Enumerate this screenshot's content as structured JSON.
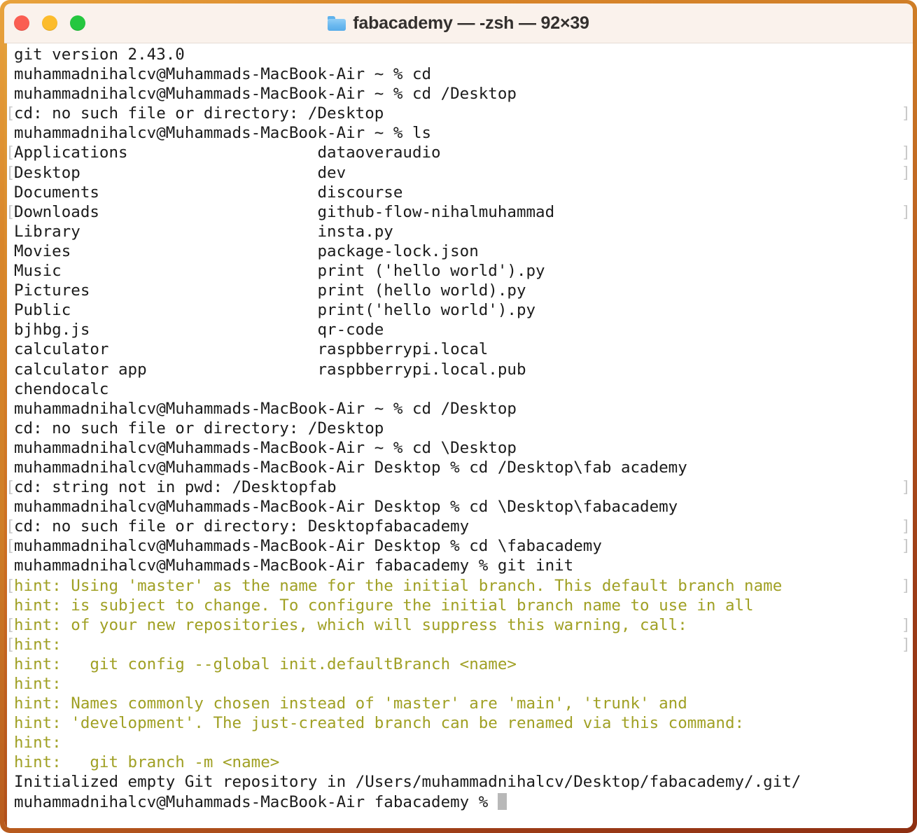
{
  "window": {
    "title": "fabacademy — -zsh — 92×39",
    "folder_icon": "folder-icon",
    "columns": 92,
    "rows": 39,
    "shell": "-zsh",
    "directory": "fabacademy",
    "traffic_lights": {
      "close_label": "close",
      "minimize_label": "minimize",
      "maximize_label": "maximize",
      "close_color": "#fa5e52",
      "minimize_color": "#fcbc2c",
      "maximize_color": "#25c73f"
    },
    "colors": {
      "frame_border": "#d9862a",
      "titlebar_bg": "#faf2ec",
      "body_bg": "#ffffff",
      "text": "#1b1b1b",
      "hint_text": "#a0a024",
      "cursor": "#b8b8b8",
      "mark_glyph": "#c9c9c9"
    }
  },
  "terminal": {
    "prompt_user_host": "muhammadnihalcv@Muhammads-MacBook-Air",
    "cursor_glyph": "block-cursor",
    "lines": [
      {
        "text": "git version 2.43.0",
        "hint": false,
        "mark_left": false,
        "mark_right": false
      },
      {
        "text": "muhammadnihalcv@Muhammads-MacBook-Air ~ % cd",
        "hint": false,
        "mark_left": false,
        "mark_right": false
      },
      {
        "text": "muhammadnihalcv@Muhammads-MacBook-Air ~ % cd /Desktop",
        "hint": false,
        "mark_left": false,
        "mark_right": false
      },
      {
        "text": "cd: no such file or directory: /Desktop",
        "hint": false,
        "mark_left": true,
        "mark_right": true
      },
      {
        "text": "muhammadnihalcv@Muhammads-MacBook-Air ~ % ls",
        "hint": false,
        "mark_left": false,
        "mark_right": false
      },
      {
        "text": "Applications                    dataoveraudio",
        "hint": false,
        "mark_left": true,
        "mark_right": true
      },
      {
        "text": "Desktop                         dev",
        "hint": false,
        "mark_left": true,
        "mark_right": true
      },
      {
        "text": "Documents                       discourse",
        "hint": false,
        "mark_left": false,
        "mark_right": false
      },
      {
        "text": "Downloads                       github-flow-nihalmuhammad",
        "hint": false,
        "mark_left": true,
        "mark_right": true
      },
      {
        "text": "Library                         insta.py",
        "hint": false,
        "mark_left": false,
        "mark_right": false
      },
      {
        "text": "Movies                          package-lock.json",
        "hint": false,
        "mark_left": false,
        "mark_right": false
      },
      {
        "text": "Music                           print ('hello world').py",
        "hint": false,
        "mark_left": false,
        "mark_right": false
      },
      {
        "text": "Pictures                        print (hello world).py",
        "hint": false,
        "mark_left": false,
        "mark_right": false
      },
      {
        "text": "Public                          print('hello world').py",
        "hint": false,
        "mark_left": false,
        "mark_right": false
      },
      {
        "text": "bjhbg.js                        qr-code",
        "hint": false,
        "mark_left": false,
        "mark_right": false
      },
      {
        "text": "calculator                      raspbberrypi.local",
        "hint": false,
        "mark_left": false,
        "mark_right": false
      },
      {
        "text": "calculator app                  raspbberrypi.local.pub",
        "hint": false,
        "mark_left": false,
        "mark_right": false
      },
      {
        "text": "chendocalc",
        "hint": false,
        "mark_left": false,
        "mark_right": false
      },
      {
        "text": "muhammadnihalcv@Muhammads-MacBook-Air ~ % cd /Desktop",
        "hint": false,
        "mark_left": false,
        "mark_right": false
      },
      {
        "text": "cd: no such file or directory: /Desktop",
        "hint": false,
        "mark_left": false,
        "mark_right": false
      },
      {
        "text": "muhammadnihalcv@Muhammads-MacBook-Air ~ % cd \\Desktop",
        "hint": false,
        "mark_left": false,
        "mark_right": false
      },
      {
        "text": "muhammadnihalcv@Muhammads-MacBook-Air Desktop % cd /Desktop\\fab academy",
        "hint": false,
        "mark_left": false,
        "mark_right": false
      },
      {
        "text": "cd: string not in pwd: /Desktopfab",
        "hint": false,
        "mark_left": true,
        "mark_right": true
      },
      {
        "text": "muhammadnihalcv@Muhammads-MacBook-Air Desktop % cd \\Desktop\\fabacademy",
        "hint": false,
        "mark_left": false,
        "mark_right": false
      },
      {
        "text": "cd: no such file or directory: Desktopfabacademy",
        "hint": false,
        "mark_left": true,
        "mark_right": true
      },
      {
        "text": "muhammadnihalcv@Muhammads-MacBook-Air Desktop % cd \\fabacademy",
        "hint": false,
        "mark_left": true,
        "mark_right": true
      },
      {
        "text": "muhammadnihalcv@Muhammads-MacBook-Air fabacademy % git init",
        "hint": false,
        "mark_left": false,
        "mark_right": false
      },
      {
        "text": "hint: Using 'master' as the name for the initial branch. This default branch name",
        "hint": true,
        "mark_left": true,
        "mark_right": true
      },
      {
        "text": "hint: is subject to change. To configure the initial branch name to use in all",
        "hint": true,
        "mark_left": false,
        "mark_right": false
      },
      {
        "text": "hint: of your new repositories, which will suppress this warning, call:",
        "hint": true,
        "mark_left": true,
        "mark_right": true
      },
      {
        "text": "hint:",
        "hint": true,
        "mark_left": true,
        "mark_right": true
      },
      {
        "text": "hint:   git config --global init.defaultBranch <name>",
        "hint": true,
        "mark_left": false,
        "mark_right": false
      },
      {
        "text": "hint:",
        "hint": true,
        "mark_left": false,
        "mark_right": false
      },
      {
        "text": "hint: Names commonly chosen instead of 'master' are 'main', 'trunk' and",
        "hint": true,
        "mark_left": false,
        "mark_right": false
      },
      {
        "text": "hint: 'development'. The just-created branch can be renamed via this command:",
        "hint": true,
        "mark_left": false,
        "mark_right": false
      },
      {
        "text": "hint:",
        "hint": true,
        "mark_left": false,
        "mark_right": false
      },
      {
        "text": "hint:   git branch -m <name>",
        "hint": true,
        "mark_left": false,
        "mark_right": false
      },
      {
        "text": "Initialized empty Git repository in /Users/muhammadnihalcv/Desktop/fabacademy/.git/",
        "hint": false,
        "mark_left": false,
        "mark_right": false
      }
    ],
    "final_prompt": "muhammadnihalcv@Muhammads-MacBook-Air fabacademy % "
  }
}
